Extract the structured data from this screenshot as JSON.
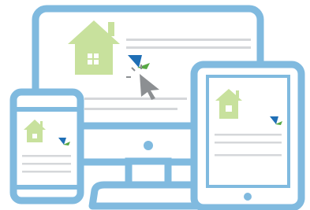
{
  "illustration": {
    "devices": [
      "desktop-monitor",
      "tablet",
      "phone"
    ],
    "icons": [
      "house-icon",
      "brand-logo-icon",
      "click-cursor-icon"
    ],
    "colors": {
      "device_frame": "#80BADF",
      "screen_bg": "#FFFFFF",
      "house_green": "#C8E19D",
      "text_line_gray": "#D5D7DA",
      "logo_blue": "#1F6FB6",
      "logo_green": "#58A845",
      "cursor_gray": "#8C8F92"
    }
  }
}
